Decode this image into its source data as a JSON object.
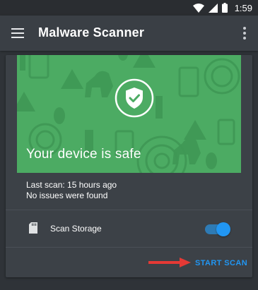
{
  "status_bar": {
    "time": "1:59",
    "icons": [
      "wifi-icon",
      "signal-icon",
      "battery-icon"
    ]
  },
  "app_bar": {
    "title": "Malware Scanner",
    "menu_icon": "hamburger-menu-icon",
    "overflow_icon": "overflow-menu-icon"
  },
  "card": {
    "hero": {
      "message": "Your device is safe",
      "badge_icon": "shield-check-icon",
      "background_color": "#4cab63"
    },
    "info": {
      "last_scan": "Last scan: 15 hours ago",
      "issues": "No issues were found"
    },
    "storage": {
      "icon": "sd-card-icon",
      "label": "Scan Storage",
      "enabled": true
    },
    "action": {
      "label": "START SCAN",
      "color": "#2196f3"
    }
  },
  "colors": {
    "annotation_arrow": "#e53935"
  }
}
